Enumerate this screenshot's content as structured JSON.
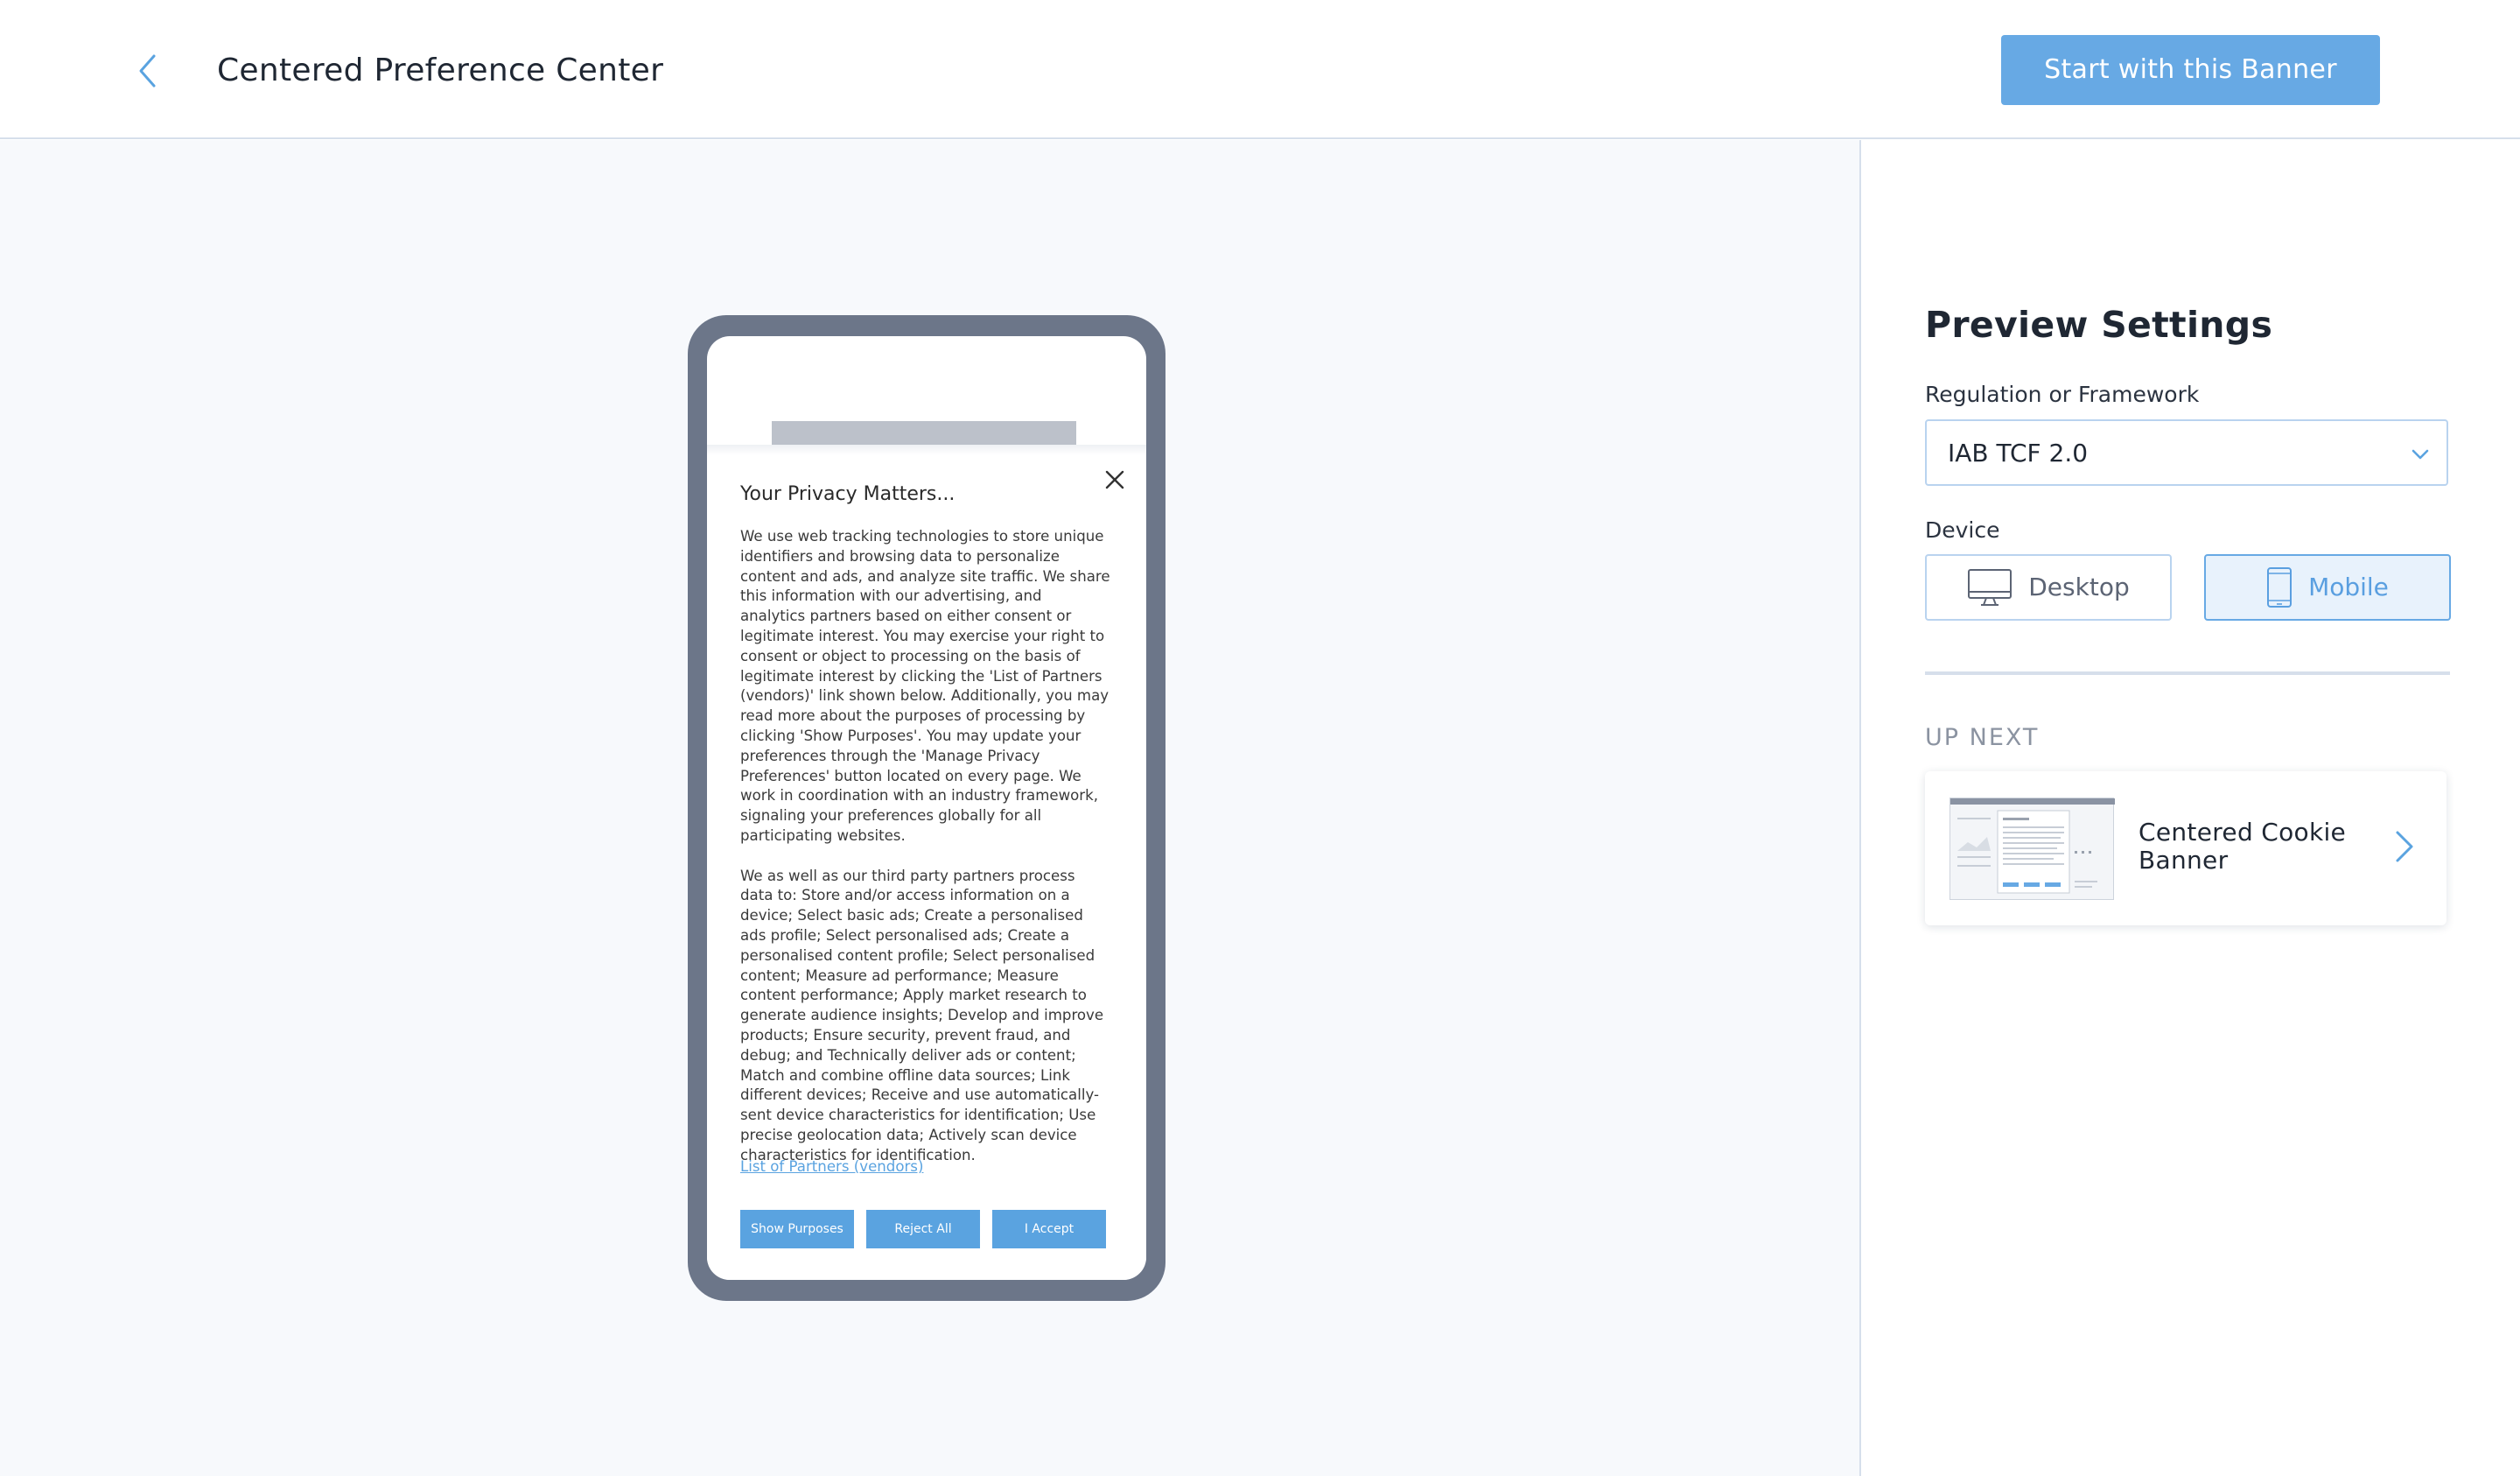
{
  "header": {
    "title": "Centered Preference Center",
    "start_button": "Start with this Banner"
  },
  "banner": {
    "title": "Your Privacy Matters...",
    "paragraph1": "We use web tracking technologies to store unique identifiers and browsing data to personalize content and ads, and analyze site traffic. We share this information with our advertising, and analytics partners based on either consent or legitimate interest. You may exercise your right to consent or object to processing on the basis of legitimate interest by clicking the 'List of Partners (vendors)' link shown below. Additionally, you may read more about the purposes of processing by clicking 'Show Purposes'. You may update your preferences through the 'Manage Privacy Preferences' button located on every page. We work in coordination with an industry framework, signaling your preferences globally for all participating websites.",
    "paragraph2": "We as well as our third party partners process data to: Store and/or access information on a device; Select basic ads; Create a personalised ads profile; Select personalised ads; Create a personalised content profile; Select personalised content; Measure ad performance; Measure content performance; Apply market research to generate audience insights; Develop and improve products; Ensure security, prevent fraud, and debug; and Technically deliver ads or content; Match and combine offline data sources; Link different devices; Receive and use automatically-sent device characteristics for identification; Use precise geolocation data; Actively scan device characteristics for identification.",
    "partners_link": "List of Partners (vendors)",
    "buttons": {
      "show_purposes": "Show Purposes",
      "reject_all": "Reject All",
      "accept": "I Accept"
    }
  },
  "settings": {
    "title": "Preview Settings",
    "regulation_label": "Regulation or Framework",
    "regulation_value": "IAB TCF 2.0",
    "device_label": "Device",
    "devices": [
      {
        "label": "Desktop",
        "icon": "desktop-monitor-icon",
        "selected": false
      },
      {
        "label": "Mobile",
        "icon": "mobile-phone-icon",
        "selected": true
      }
    ],
    "up_next_label": "UP NEXT",
    "up_next_title": "Centered Cookie Banner"
  },
  "colors": {
    "accent": "#67a9e4",
    "banner_button": "#5aa3e0",
    "phone_frame": "#6c7689",
    "preview_bg": "#f7f9fc",
    "border": "#d6dfeb"
  }
}
